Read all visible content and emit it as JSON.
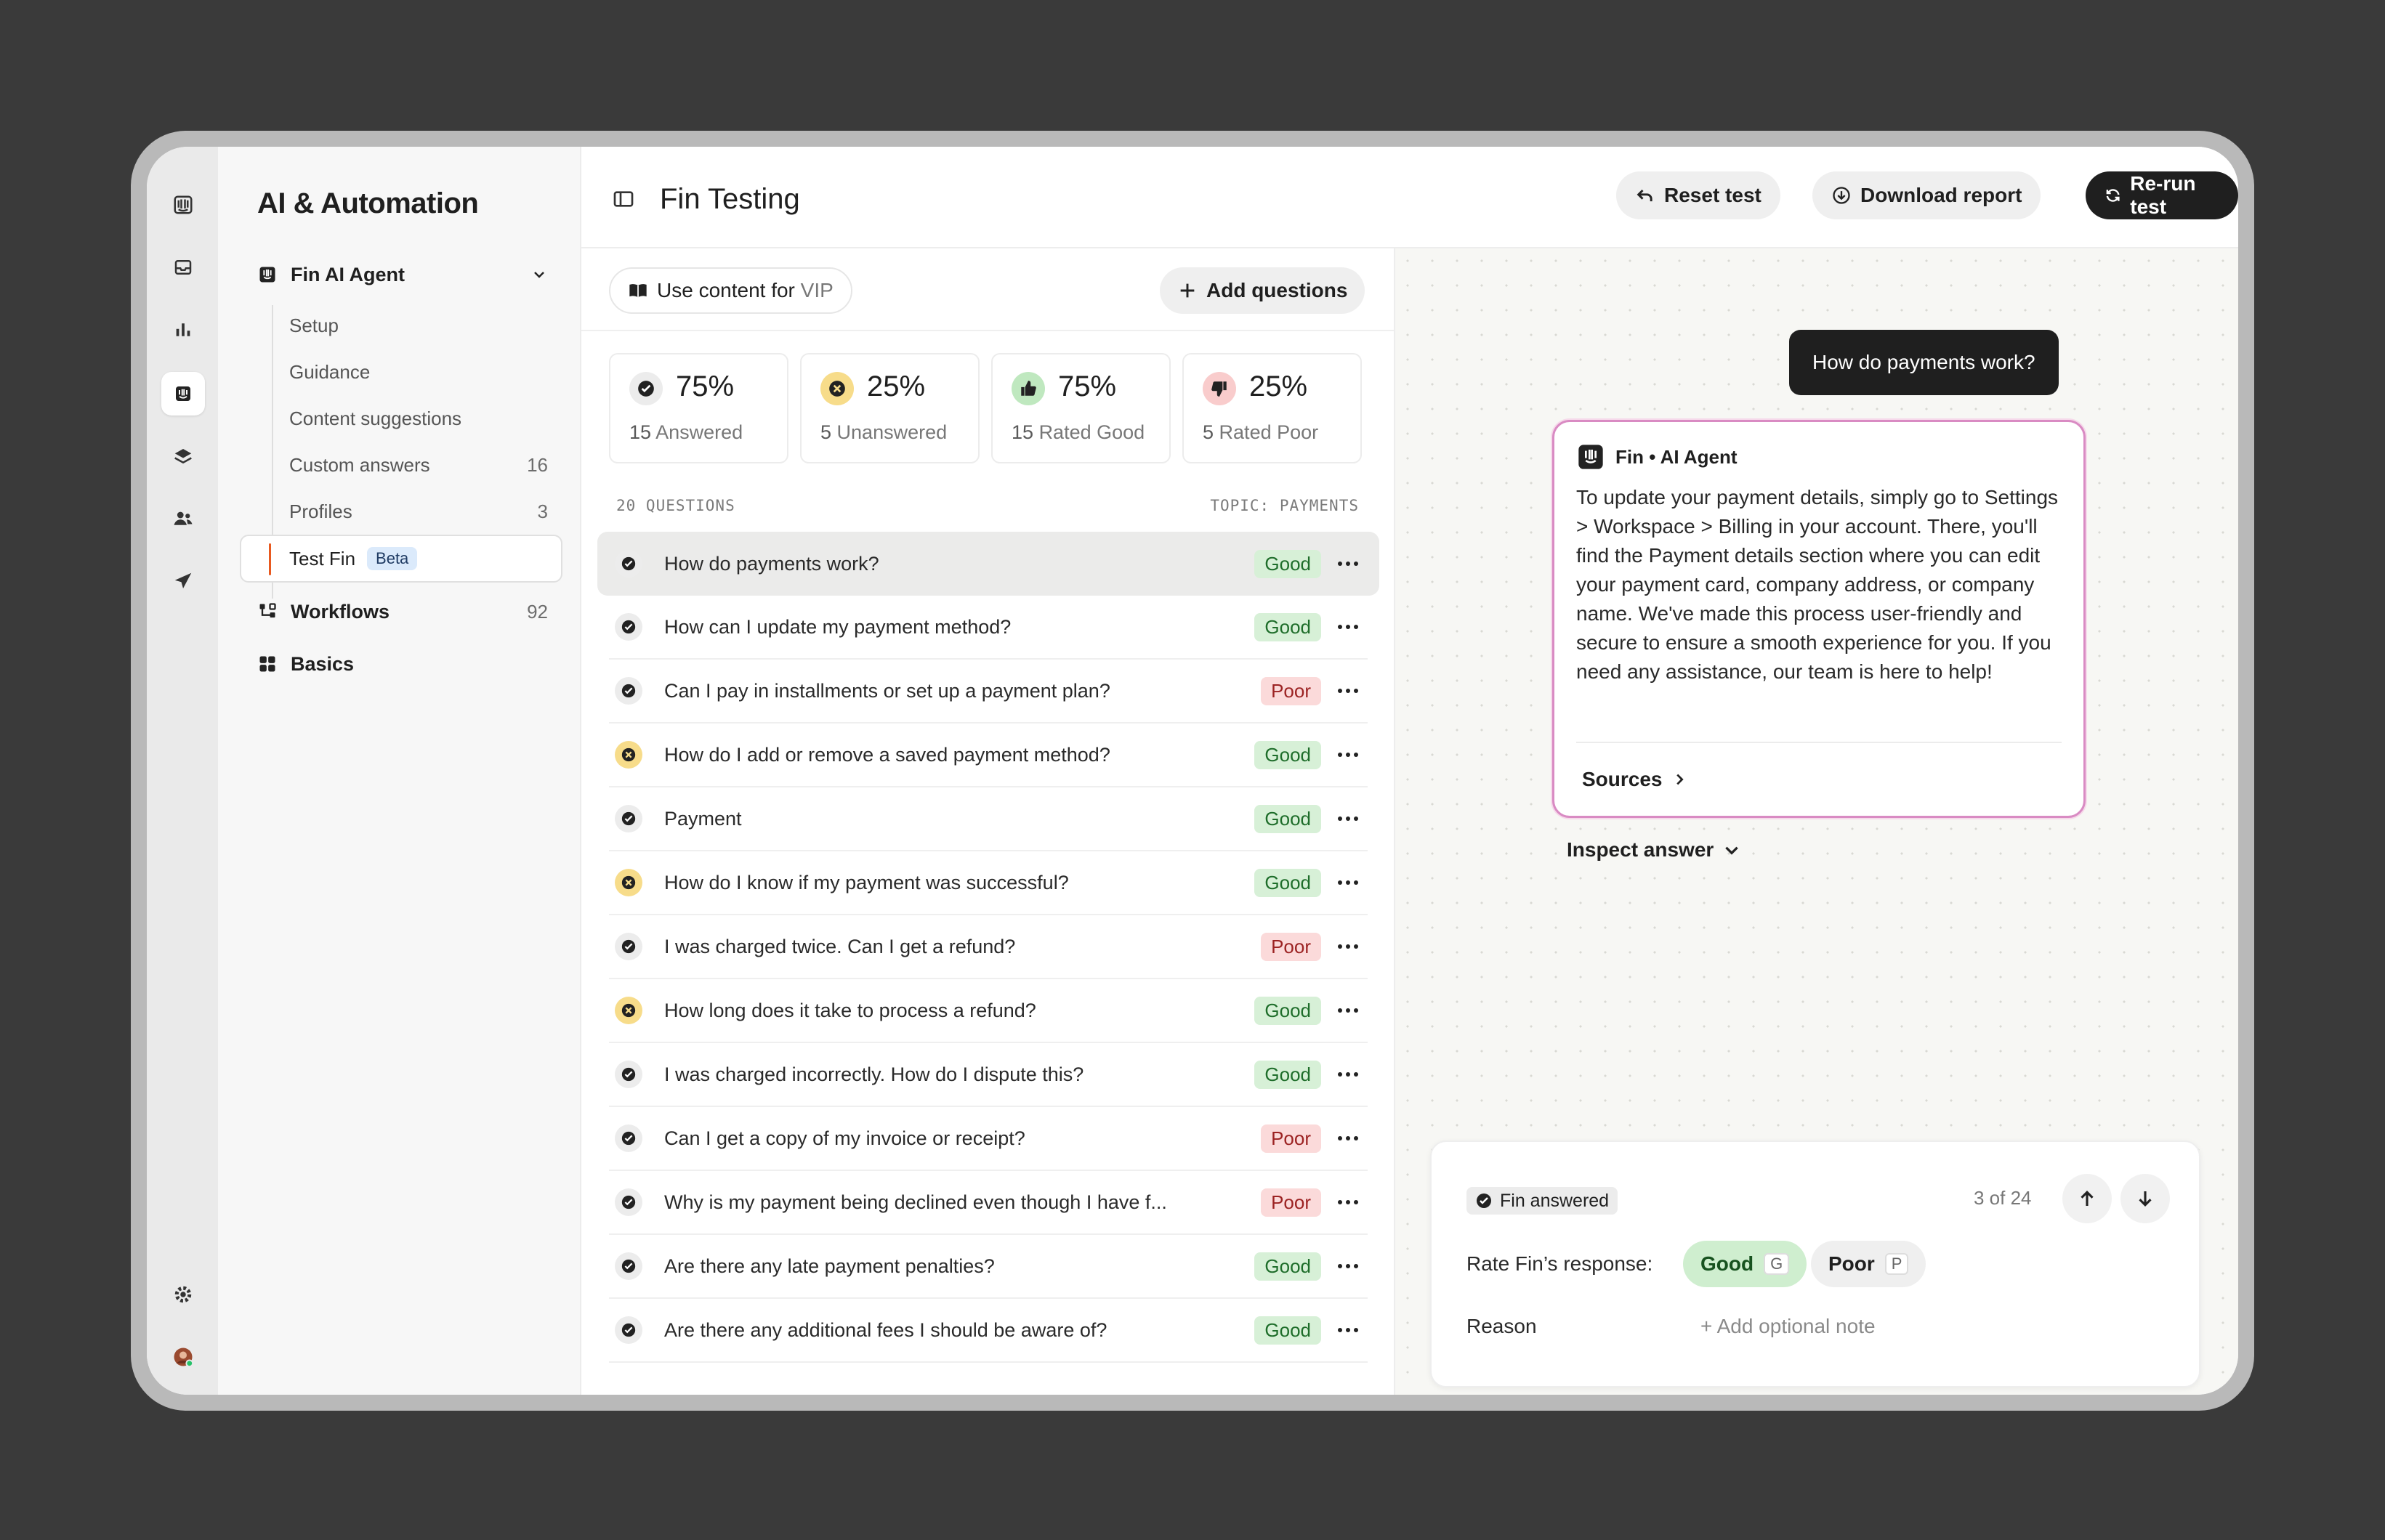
{
  "sidebar": {
    "title": "AI & Automation",
    "fin_agent": "Fin AI Agent",
    "items": [
      {
        "label": "Setup",
        "count": ""
      },
      {
        "label": "Guidance",
        "count": ""
      },
      {
        "label": "Content suggestions",
        "count": ""
      },
      {
        "label": "Custom answers",
        "count": "16"
      },
      {
        "label": "Profiles",
        "count": "3"
      }
    ],
    "active_item": {
      "label": "Test Fin",
      "badge": "Beta"
    },
    "workflows": {
      "label": "Workflows",
      "count": "92"
    },
    "basics": {
      "label": "Basics"
    }
  },
  "header": {
    "title": "Fin Testing",
    "reset": "Reset test",
    "download": "Download report",
    "rerun": "Re-run test"
  },
  "toolbar": {
    "use_content_prefix": "Use content for",
    "use_content_value": "VIP",
    "add_questions": "Add questions"
  },
  "stats": [
    {
      "pct": "75%",
      "num": "15",
      "label": "Answered",
      "icon": "check-circle-icon"
    },
    {
      "pct": "25%",
      "num": "5",
      "label": "Unanswered",
      "icon": "x-circle-icon"
    },
    {
      "pct": "75%",
      "num": "15",
      "label": "Rated Good",
      "icon": "thumbs-up-icon"
    },
    {
      "pct": "25%",
      "num": "5",
      "label": "Rated Poor",
      "icon": "thumbs-down-icon"
    }
  ],
  "list_header": {
    "count": "20 QUESTIONS",
    "topic": "TOPIC: PAYMENTS"
  },
  "questions": [
    {
      "text": "How do payments work?",
      "rating": "Good",
      "status": "answered"
    },
    {
      "text": "How can I update my payment method?",
      "rating": "Good",
      "status": "answered"
    },
    {
      "text": "Can I pay in installments or set up a payment plan?",
      "rating": "Poor",
      "status": "answered"
    },
    {
      "text": "How do I add or remove a saved payment method?",
      "rating": "Good",
      "status": "unanswered"
    },
    {
      "text": "Payment",
      "rating": "Good",
      "status": "answered"
    },
    {
      "text": "How do I know if my payment was successful?",
      "rating": "Good",
      "status": "unanswered"
    },
    {
      "text": "I was charged twice. Can I get a refund?",
      "rating": "Poor",
      "status": "answered"
    },
    {
      "text": "How long does it take to process a refund?",
      "rating": "Good",
      "status": "unanswered"
    },
    {
      "text": "I was charged incorrectly. How do I dispute this?",
      "rating": "Good",
      "status": "answered"
    },
    {
      "text": "Can I get a copy of my invoice or receipt?",
      "rating": "Poor",
      "status": "answered"
    },
    {
      "text": "Why is my payment being declined even though I have f...",
      "rating": "Poor",
      "status": "answered"
    },
    {
      "text": "Are there any late payment penalties?",
      "rating": "Good",
      "status": "answered"
    },
    {
      "text": "Are there any additional fees I should be aware of?",
      "rating": "Good",
      "status": "answered"
    }
  ],
  "preview": {
    "user_message": "How do payments work?",
    "agent_name": "Fin • AI Agent",
    "answer": "To update your payment details, simply go to Settings > Workspace > Billing in your account. There, you'll find the Payment details section where you can edit your payment card, company address, or company name. We've made this process user-friendly and secure to ensure a smooth experience for you. If you need any assistance, our team is here to help!",
    "sources": "Sources",
    "inspect": "Inspect answer"
  },
  "rating_panel": {
    "status": "Fin answered",
    "position": "3 of 24",
    "rate_label": "Rate Fin’s response:",
    "good": "Good",
    "good_key": "G",
    "poor": "Poor",
    "poor_key": "P",
    "reason_label": "Reason",
    "note_placeholder": "+ Add optional note"
  },
  "colors": {
    "accent": "#e8591f",
    "good_bg": "#d7f0d7",
    "poor_bg": "#fbdada",
    "unanswered": "#f7dc8a",
    "highlight_border": "#d98bc3"
  }
}
